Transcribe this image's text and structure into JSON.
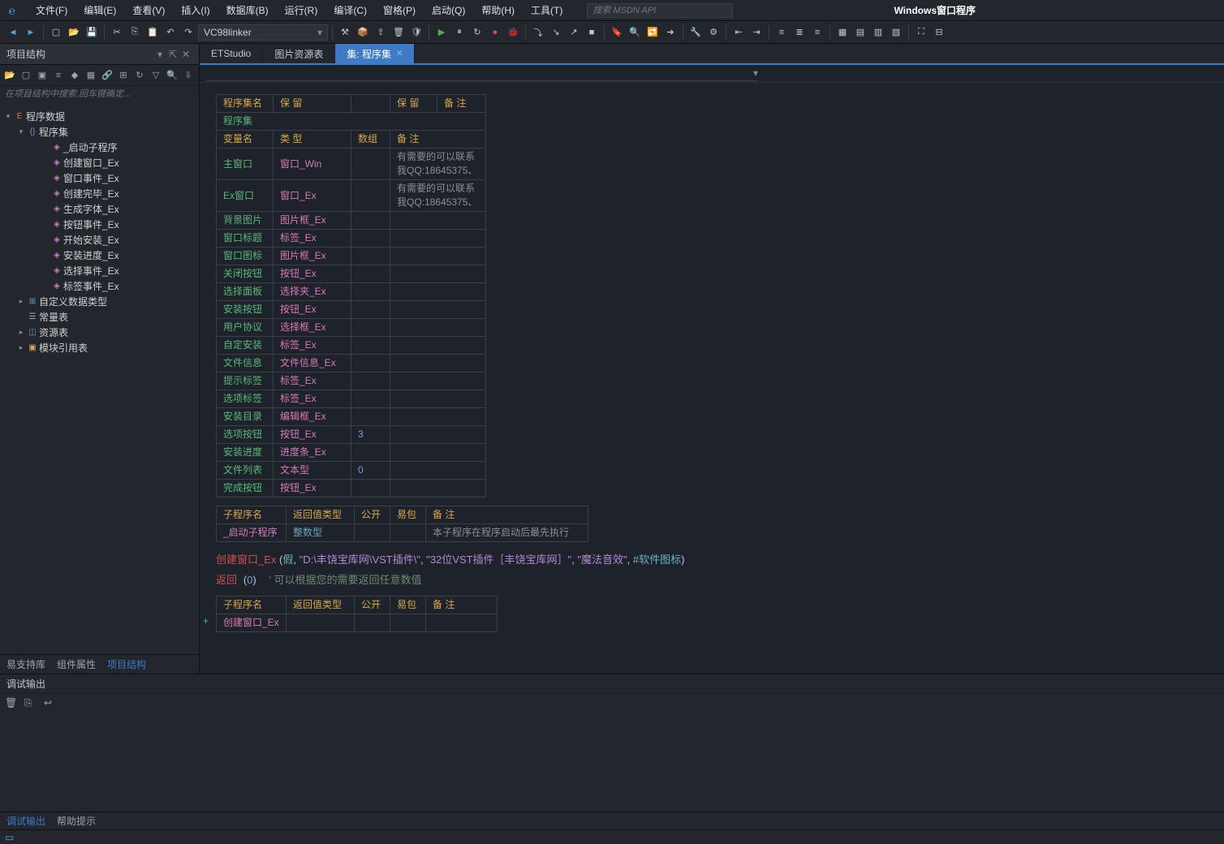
{
  "app": {
    "title": "Windows窗口程序"
  },
  "menubar": {
    "items": [
      "文件(F)",
      "编辑(E)",
      "查看(V)",
      "插入(I)",
      "数据库(B)",
      "运行(R)",
      "编译(C)",
      "窗格(P)",
      "启动(Q)",
      "帮助(H)",
      "工具(T)"
    ],
    "search_placeholder": "搜索 MSDN API"
  },
  "toolbar": {
    "linker": "VC98linker"
  },
  "left_panel": {
    "title": "项目结构",
    "search_placeholder": "在项目结构中搜索,回车键确定...",
    "root": "程序数据",
    "assembly": "程序集",
    "subs": [
      "_启动子程序",
      "创建窗口_Ex",
      "窗口事件_Ex",
      "创建完毕_Ex",
      "生成字体_Ex",
      "按钮事件_Ex",
      "开始安装_Ex",
      "安装进度_Ex",
      "选择事件_Ex",
      "标签事件_Ex"
    ],
    "other": [
      "自定义数据类型",
      "常量表",
      "资源表",
      "模块引用表"
    ],
    "tabs": [
      "易支持库",
      "组件属性",
      "项目结构"
    ]
  },
  "editor": {
    "tabs": [
      {
        "label": "ETStudio",
        "active": false
      },
      {
        "label": "图片资源表",
        "active": false
      },
      {
        "label": "集: 程序集",
        "active": true
      }
    ],
    "header_table": {
      "row1": [
        "程序集名",
        "保  留",
        "",
        "保  留",
        "备  注"
      ],
      "row2": "程序集"
    },
    "var_header": [
      "变量名",
      "类  型",
      "数组",
      "备  注"
    ],
    "vars": [
      {
        "name": "主窗口",
        "type": "窗口_Win",
        "arr": "",
        "remark": "有需要的可以联系我QQ:18645375、"
      },
      {
        "name": "Ex窗口",
        "type": "窗口_Ex",
        "arr": "",
        "remark": "有需要的可以联系我QQ:18645375、"
      },
      {
        "name": "背景图片",
        "type": "图片框_Ex",
        "arr": "",
        "remark": ""
      },
      {
        "name": "窗口标题",
        "type": "标签_Ex",
        "arr": "",
        "remark": ""
      },
      {
        "name": "窗口图标",
        "type": "图片框_Ex",
        "arr": "",
        "remark": ""
      },
      {
        "name": "关闭按钮",
        "type": "按钮_Ex",
        "arr": "",
        "remark": ""
      },
      {
        "name": "选择面板",
        "type": "选择夹_Ex",
        "arr": "",
        "remark": ""
      },
      {
        "name": "安装按钮",
        "type": "按钮_Ex",
        "arr": "",
        "remark": ""
      },
      {
        "name": "用户协议",
        "type": "选择框_Ex",
        "arr": "",
        "remark": ""
      },
      {
        "name": "自定安装",
        "type": "标签_Ex",
        "arr": "",
        "remark": ""
      },
      {
        "name": "文件信息",
        "type": "文件信息_Ex",
        "arr": "",
        "remark": ""
      },
      {
        "name": "提示标签",
        "type": "标签_Ex",
        "arr": "",
        "remark": ""
      },
      {
        "name": "选项标签",
        "type": "标签_Ex",
        "arr": "",
        "remark": ""
      },
      {
        "name": "安装目录",
        "type": "编辑框_Ex",
        "arr": "",
        "remark": ""
      },
      {
        "name": "选项按钮",
        "type": "按钮_Ex",
        "arr": "3",
        "remark": ""
      },
      {
        "name": "安装进度",
        "type": "进度条_Ex",
        "arr": "",
        "remark": ""
      },
      {
        "name": "文件列表",
        "type": "文本型",
        "arr": "0",
        "remark": ""
      },
      {
        "name": "完成按钮",
        "type": "按钮_Ex",
        "arr": "",
        "remark": ""
      }
    ],
    "sub_header": [
      "子程序名",
      "返回值类型",
      "公开",
      "易包",
      "备  注"
    ],
    "sub1": {
      "name": "_启动子程序",
      "ret": "整数型",
      "remark": "本子程序在程序启动后最先执行"
    },
    "code": {
      "call": "创建窗口_Ex",
      "false_kw": "假",
      "path": "\"D:\\丰饶宝库网\\VST插件\\\"",
      "arg2": "\"32位VST插件［丰饶宝库网］\"",
      "arg3": "\"魔法音效\"",
      "arg4": "#软件图标",
      "ret_kw": "返回",
      "ret_val": "0",
      "ret_comment": "' 可以根据您的需要返回任意数值"
    },
    "sub2": {
      "name": "创建窗口_Ex"
    }
  },
  "debug": {
    "title": "调试输出"
  },
  "bottom_tabs": [
    "调试输出",
    "帮助提示"
  ]
}
